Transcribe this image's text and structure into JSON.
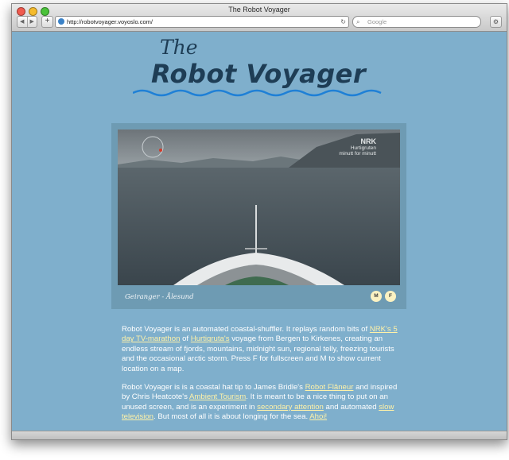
{
  "window": {
    "title": "The Robot Voyager"
  },
  "toolbar": {
    "back_glyph": "◀",
    "forward_glyph": "▶",
    "add_glyph": "+",
    "url": "http://robotvoyager.voyoslo.com/",
    "reload_glyph": "↻",
    "search_placeholder": "Google",
    "search_glyph": "⌕",
    "settings_glyph": "⚙"
  },
  "header": {
    "logo_the": "The",
    "logo_main": "Robot Voyager"
  },
  "player": {
    "watermark_line1": "NRK",
    "watermark_line2": "Hurtigruten",
    "watermark_line3": "minutt for minutt",
    "caption": "Geiranger - Ålesund",
    "map_button": "M",
    "fullscreen_button": "F"
  },
  "content": {
    "p1": {
      "t1": "Robot Voyager is an automated coastal-shuffler. It replays random bits of ",
      "l1": "NRK's 5 day TV-marathon",
      "t2": " of ",
      "l2": "Hurtigruta's",
      "t3": " voyage from Bergen to Kirkenes, creating an endless stream of fjords, mountains, midnight sun, regional telly, freezing tourists and the occasional arctic storm. Press F for fullscreen and M to show current location on a map."
    },
    "p2": {
      "t1": "Robot Voyager is is a coastal hat tip to James Bridle's ",
      "l1": "Robot Flâneur",
      "t2": " and inspired by Chris Heatcote's ",
      "l2": "Ambient Tourism",
      "t3": ". It is meant to be a nice thing to put on an unused screen, and is an experiment in ",
      "l3": "secondary attention",
      "t4": " and automated ",
      "l4": "slow television",
      "t5": ". But most of all it is about longing for the sea. ",
      "l5": "Ahoi!"
    }
  },
  "colors": {
    "page_bg": "#7fafcc",
    "logo": "#1e3d55",
    "link": "#fff2a8",
    "wave": "#1f80d6"
  }
}
